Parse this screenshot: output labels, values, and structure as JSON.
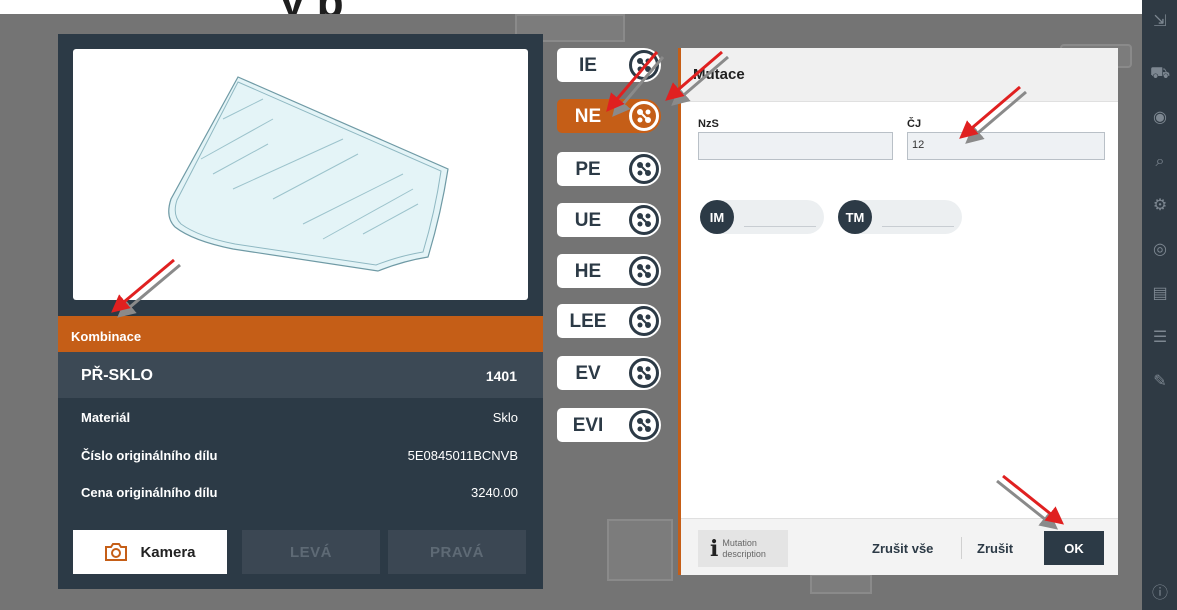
{
  "header": {
    "title_fragment": "y p"
  },
  "panel": {
    "combo_label": "Kombinace",
    "part_name": "PŘ-SKLO",
    "part_code": "1401",
    "rows": [
      {
        "label": "Materiál",
        "value": "Sklo"
      },
      {
        "label": "Číslo originálního dílu",
        "value": "5E0845011BCNVB"
      },
      {
        "label": "Cena originálního dílu",
        "value": "3240.00"
      }
    ],
    "camera_label": "Kamera",
    "left_label": "LEVÁ",
    "right_label": "PRAVÁ"
  },
  "tabs": [
    {
      "label": "IE",
      "active": false
    },
    {
      "label": "NE",
      "active": true
    },
    {
      "label": "PE",
      "active": false
    },
    {
      "label": "UE",
      "active": false
    },
    {
      "label": "HE",
      "active": false
    },
    {
      "label": "LEE",
      "active": false
    },
    {
      "label": "EV",
      "active": false
    },
    {
      "label": "EVI",
      "active": false
    }
  ],
  "dialog": {
    "title": "Mutace",
    "nzs_label": "NzS",
    "nzs_value": "",
    "cj_label": "ČJ",
    "cj_value": "12",
    "im_label": "IM",
    "tm_label": "TM",
    "mutation_desc": [
      "Mutation",
      "description"
    ],
    "cancel_all": "Zrušit vše",
    "cancel": "Zrušit",
    "ok": "OK"
  },
  "colors": {
    "accent": "#c55e17",
    "dark": "#2c3a46",
    "arrow": "#e02020"
  },
  "icons": [
    "exit-icon",
    "car-icon",
    "damage-icon",
    "search-icon",
    "settings-icon",
    "camera-icon",
    "monitor-icon",
    "list-icon",
    "edit-icon",
    "info-icon"
  ]
}
